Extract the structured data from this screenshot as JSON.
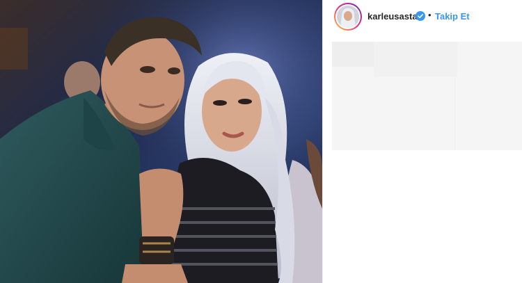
{
  "post": {
    "username": "karleusastar",
    "separator": "•",
    "follow_label": "Takip Et",
    "image_icon": "photo",
    "verified_icon": "verified-badge-icon",
    "colors": {
      "follow": "#3897f0",
      "username": "#262626",
      "verified": "#3897f0",
      "placeholder": "#f5f5f5"
    }
  }
}
